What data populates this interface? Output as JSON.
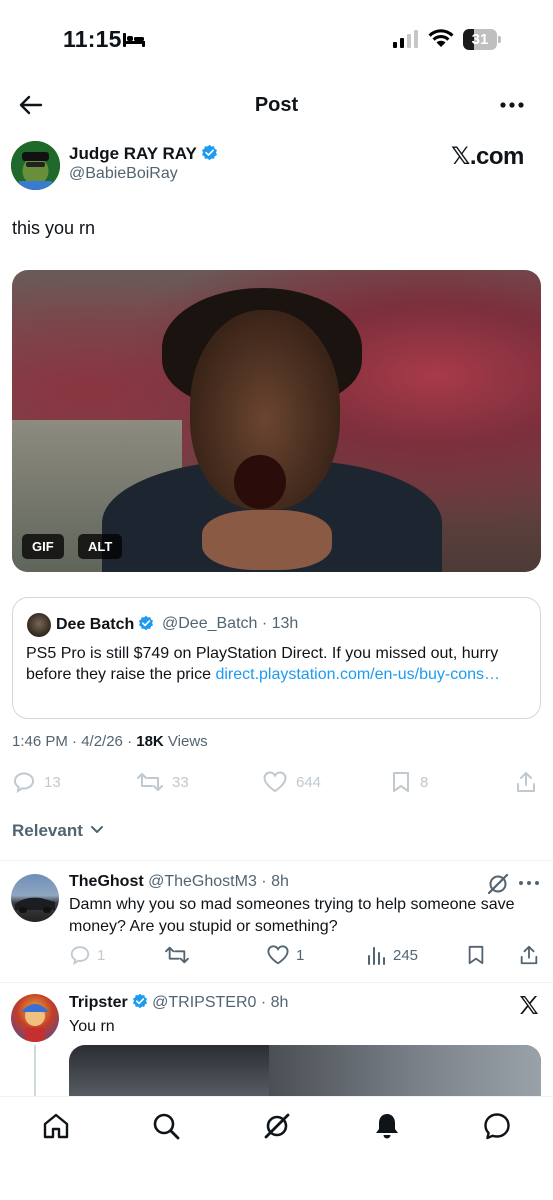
{
  "status_bar": {
    "time": "11:15",
    "battery": "31",
    "battery_level": 0.31
  },
  "header": {
    "title": "Post"
  },
  "author": {
    "name": "Judge RAY RAY",
    "handle": "@BabieBoiRay",
    "watermark": "𝕏.com"
  },
  "post": {
    "text": "this you rn",
    "media_badges": {
      "gif": "GIF",
      "alt": "ALT"
    },
    "timestamp": "1:46 PM · 4/2/26 · ",
    "views_count": "18K",
    "views_label": " Views"
  },
  "quote": {
    "name": "Dee Batch",
    "handle_time": "@Dee_Batch · 13h",
    "text": "PS5 Pro is still $749 on PlayStation Direct. If you missed out, hurry before they raise the price ",
    "link": "direct.playstation.com/en-us/buy-cons…"
  },
  "actions": {
    "replies": "13",
    "reposts": "33",
    "likes": "644",
    "bookmarks": "8"
  },
  "replies_filter": {
    "label": "Relevant"
  },
  "replies": [
    {
      "name": "TheGhost",
      "handle_time": " @TheGhostM3 · 8h",
      "text": "Damn why you so mad someones trying to help someone save money? Are you stupid or something?",
      "replies": "1",
      "likes": "1",
      "views": "245"
    },
    {
      "name": "Tripster",
      "handle_time": " @TRIPSTER0 · 8h",
      "text": "You rn"
    }
  ],
  "colors": {
    "accent": "#1d9bf0",
    "text": "#0f1419",
    "muted": "#536471",
    "border": "#cfd9de"
  },
  "icons": {
    "tabs": [
      "home-icon",
      "search-icon",
      "grok-icon",
      "notifications-icon",
      "messages-icon"
    ]
  }
}
